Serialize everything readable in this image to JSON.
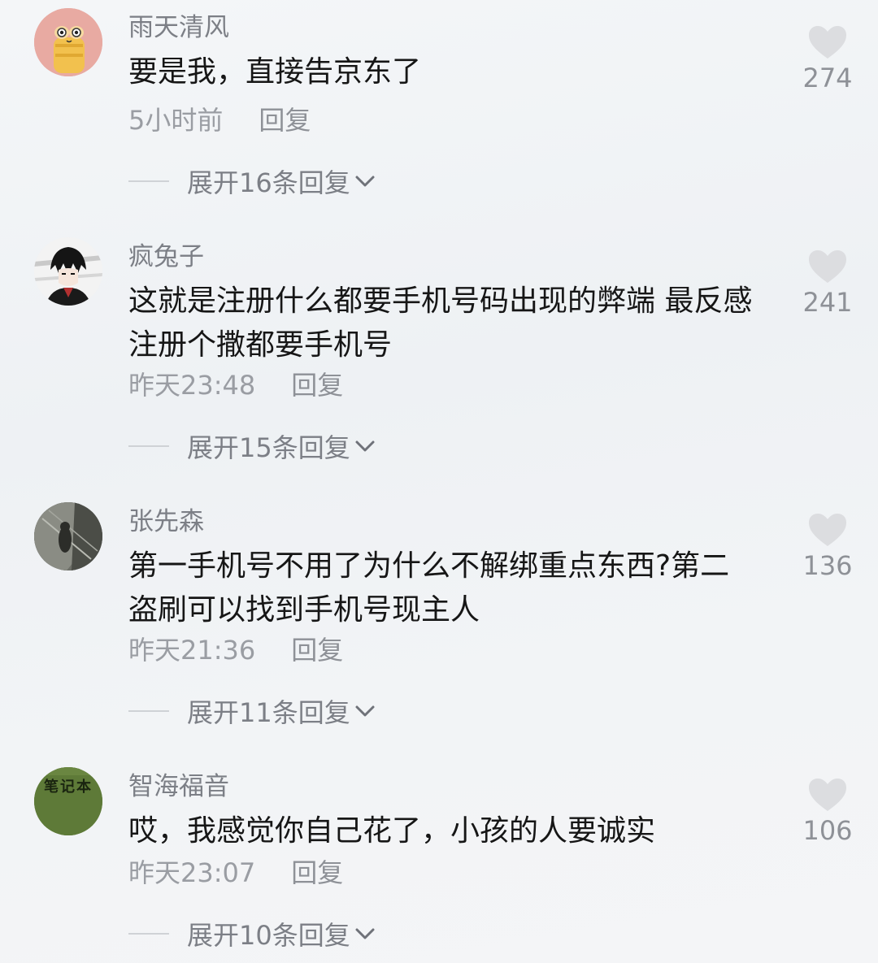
{
  "comments": [
    {
      "username": "雨天清风",
      "text": "要是我，直接告京东了",
      "time": "5小时前",
      "reply_label": "回复",
      "expand_label": "展开16条回复",
      "likes": "274",
      "avatar_icon": "cartoon-bread-avatar"
    },
    {
      "username": "疯兔子",
      "text": "这就是注册什么都要手机号码出现的弊端 最反感注册个撒都要手机号",
      "time": "昨天23:48",
      "reply_label": "回复",
      "expand_label": "展开15条回复",
      "likes": "241",
      "avatar_icon": "anime-character-avatar"
    },
    {
      "username": "张先森",
      "text": "第一手机号不用了为什么不解绑重点东西?第二盗刷可以找到手机号现主人",
      "time": "昨天21:36",
      "reply_label": "回复",
      "expand_label": "展开11条回复",
      "likes": "136",
      "avatar_icon": "dark-photo-avatar"
    },
    {
      "username": "智海福音",
      "text": "哎，我感觉你自己花了，小孩的人要诚实",
      "time": "昨天23:07",
      "reply_label": "回复",
      "expand_label": "展开10条回复",
      "likes": "106",
      "avatar_icon": "notebook-avatar",
      "avatar_text": "笔记本"
    }
  ],
  "colors": {
    "like_heart": "#dcdde0",
    "username": "#7c7f86",
    "meta": "#9a9da3"
  }
}
